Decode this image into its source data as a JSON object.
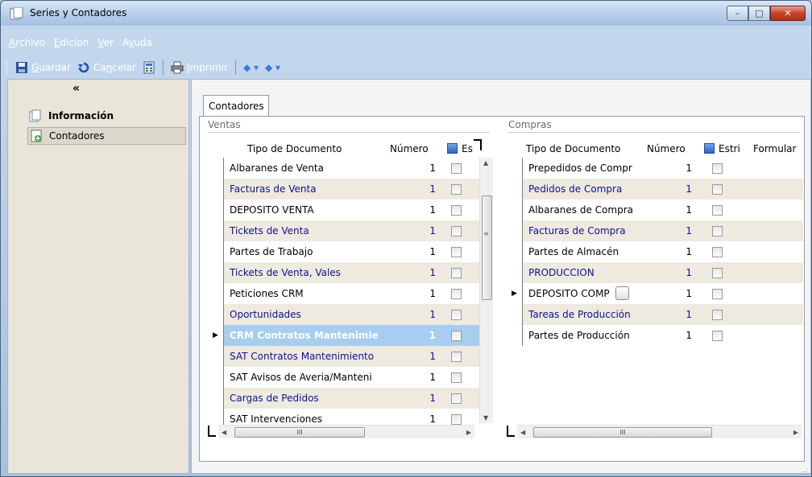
{
  "window": {
    "title": "Series y Contadores",
    "controls": {
      "minimize": "–",
      "maximize": "□",
      "close": "✕"
    }
  },
  "menu": {
    "items": [
      {
        "label": "Archivo",
        "hotkey": "A",
        "rest": "rchivo"
      },
      {
        "label": "Edicion",
        "hotkey": "E",
        "rest": "dicion"
      },
      {
        "label": "Ver",
        "hotkey": "V",
        "rest": "er"
      },
      {
        "label": "Ayuda",
        "hotkey": "y",
        "pre": "A",
        "rest": "uda"
      }
    ]
  },
  "toolbar": {
    "save": {
      "label": "Guardar",
      "hotkey": "G",
      "rest": "uardar",
      "icon": "save-icon"
    },
    "cancel": {
      "pre": "Ca",
      "hotkey": "n",
      "rest": "celar",
      "label": "Cancelar",
      "icon": "undo-icon"
    },
    "calc_icon": "calculator-icon",
    "print": {
      "label": "Imprimir",
      "hotkey": "I",
      "rest": "mprimir",
      "icon": "printer-icon"
    },
    "nav_up": "◆ ▾",
    "nav_down": "◆ ▾"
  },
  "sidebar": {
    "collapse": "«",
    "items": [
      {
        "label": "Información",
        "icon": "document-icon"
      },
      {
        "label": "Contadores",
        "icon": "counter-icon"
      }
    ]
  },
  "tabs": [
    {
      "label": "Contadores"
    }
  ],
  "ventas": {
    "group_label": "Ventas",
    "columns": {
      "type": "Tipo de Documento",
      "number": "Número",
      "extra": "Es"
    },
    "rows": [
      {
        "name": "Albaranes de Venta",
        "number": "1"
      },
      {
        "name": "Facturas de Venta",
        "number": "1"
      },
      {
        "name": "DEPOSITO VENTA",
        "number": "1"
      },
      {
        "name": "Tickets de Venta",
        "number": "1"
      },
      {
        "name": "Partes de Trabajo",
        "number": "1"
      },
      {
        "name": "Tickets de Venta, Vales",
        "number": "1"
      },
      {
        "name": "Peticiones CRM",
        "number": "1"
      },
      {
        "name": "Oportunidades",
        "number": "1"
      },
      {
        "name": "CRM Contratos Mantenimie",
        "number": "1",
        "selected": true
      },
      {
        "name": "SAT Contratos Mantenimiento",
        "number": "1"
      },
      {
        "name": "SAT Avisos de Averia/Manteni",
        "number": "1"
      },
      {
        "name": "Cargas de Pedidos",
        "number": "1"
      },
      {
        "name": "SAT Intervenciones",
        "number": "1"
      }
    ]
  },
  "compras": {
    "group_label": "Compras",
    "columns": {
      "type": "Tipo de Documento",
      "number": "Número",
      "extra": "Estri",
      "form": "Formular"
    },
    "rows": [
      {
        "name": "Prepedidos de Compr",
        "number": "1"
      },
      {
        "name": "Pedidos de Compra",
        "number": "1"
      },
      {
        "name": "Albaranes de Compra",
        "number": "1"
      },
      {
        "name": "Facturas de Compra",
        "number": "1"
      },
      {
        "name": "Partes de Almacén",
        "number": "1"
      },
      {
        "name": "PRODUCCION",
        "number": "1"
      },
      {
        "name": "DEPOSITO COMP",
        "number": "1",
        "current": true
      },
      {
        "name": "Tareas de Producción",
        "number": "1"
      },
      {
        "name": "Partes de Producción",
        "number": "1"
      }
    ]
  },
  "scroll": {
    "hthumb_glyph": "III",
    "left": "◀",
    "right": "▶",
    "grip": "≡"
  },
  "row_indicator": "▶",
  "statusbar": {
    "grip": "..:"
  }
}
